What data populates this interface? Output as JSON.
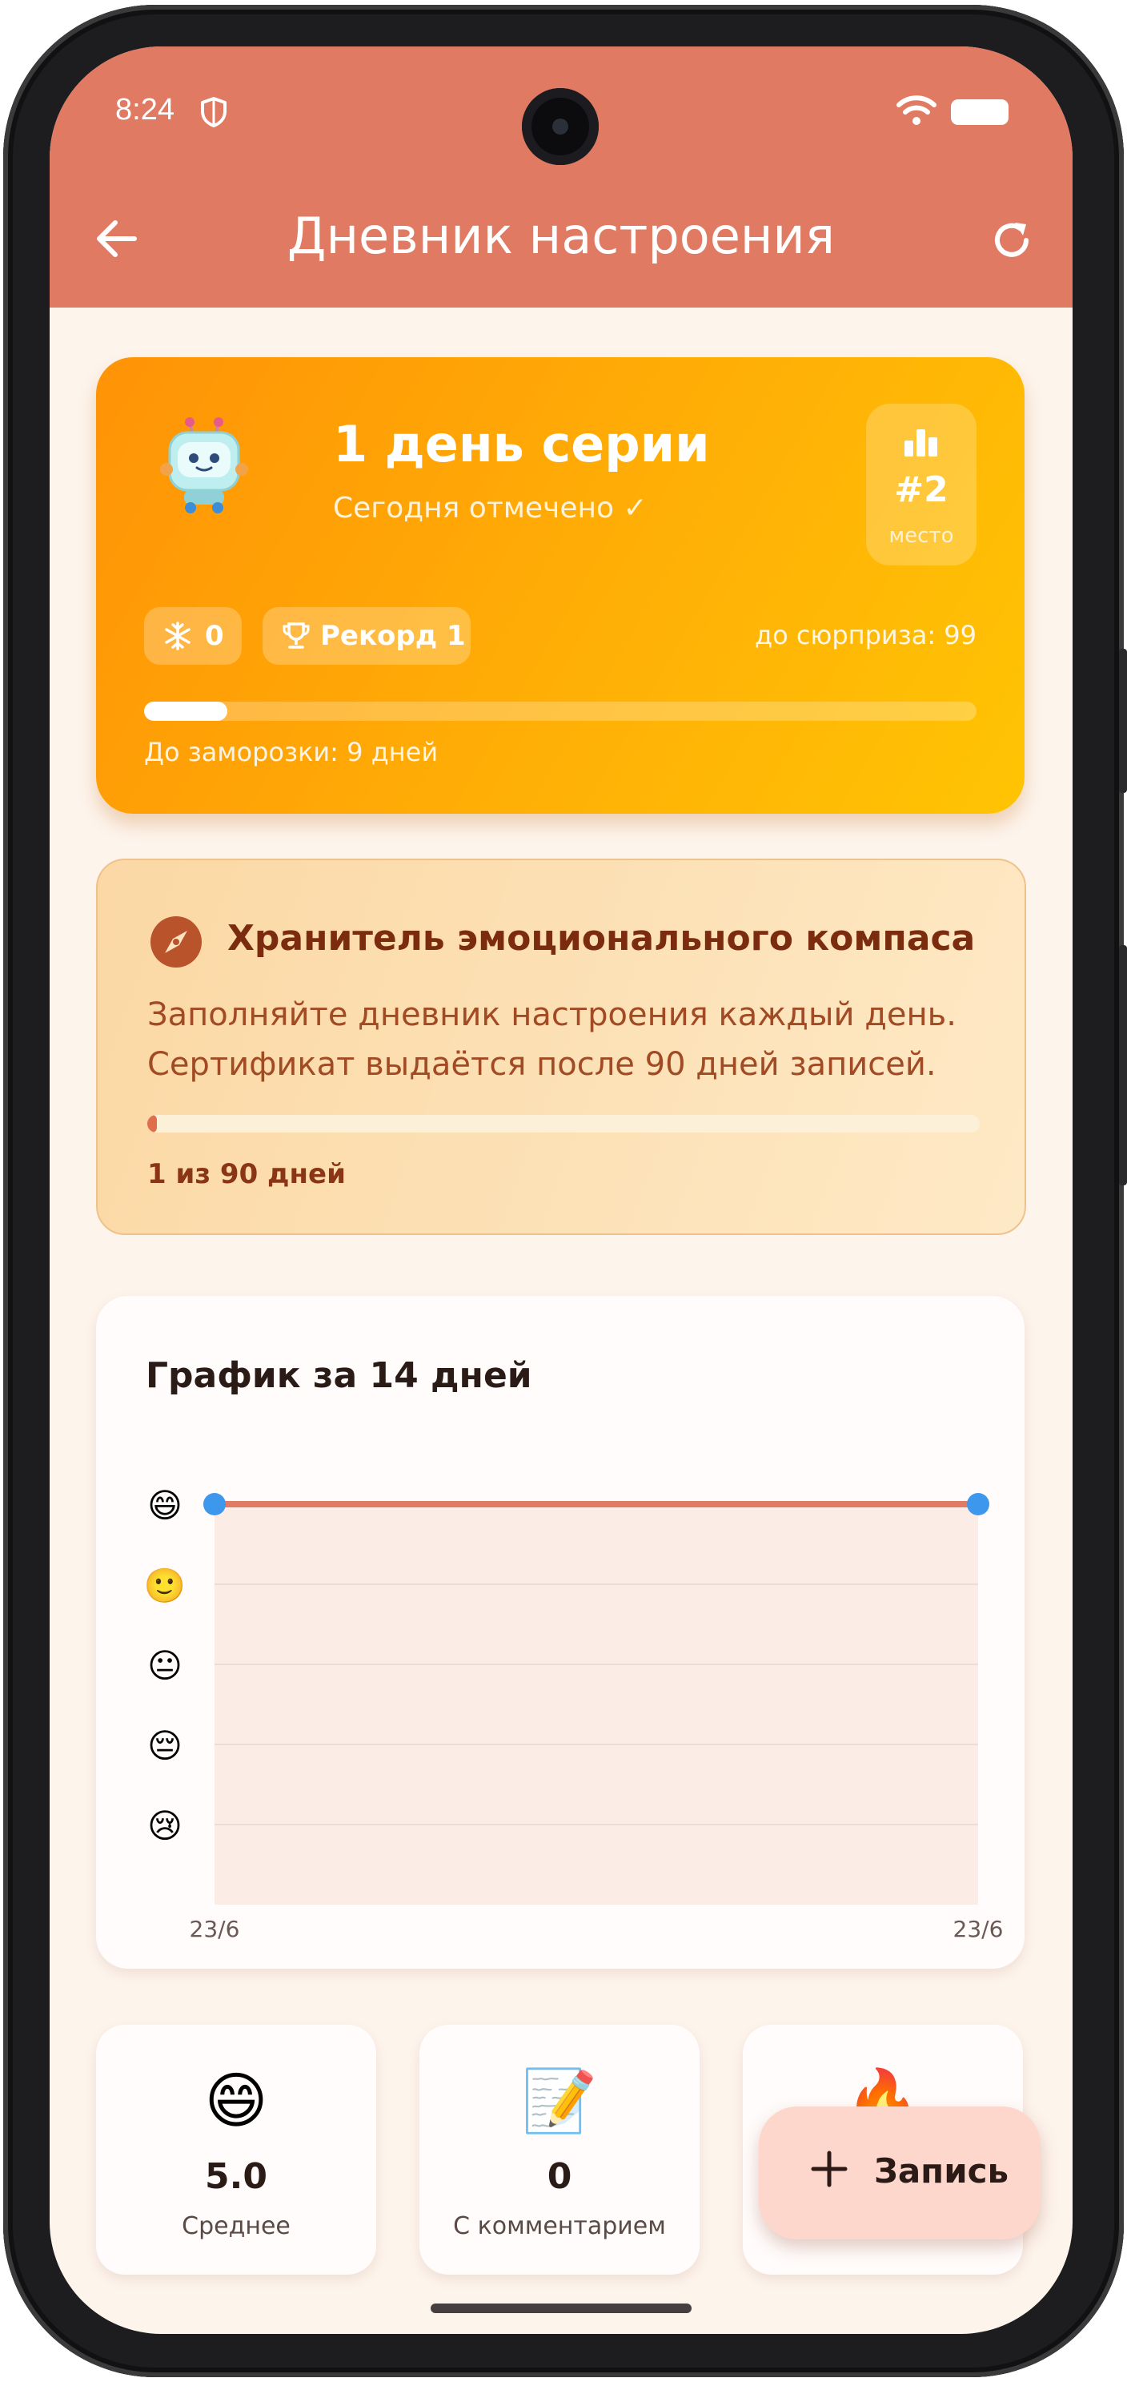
{
  "status_bar": {
    "time": "8:24"
  },
  "app_bar": {
    "title": "Дневник настроения",
    "back_icon": "arrow-back-icon",
    "refresh_icon": "refresh-icon"
  },
  "streak": {
    "mascot": "robot-icon",
    "title": "1 день серии",
    "subtitle": "Сегодня отмечено ✓",
    "rank": {
      "value": "#2",
      "label": "место",
      "icon": "bar-chart-icon"
    },
    "freeze_count": "0",
    "freeze_icon": "snowflake-icon",
    "record_label": "Рекорд 1",
    "record_icon": "trophy-icon",
    "surprise_text": "до сюрприза: 99",
    "progress_fraction": 0.1,
    "freeze_note": "До заморозки: 9 дней"
  },
  "achievement": {
    "icon": "compass-icon",
    "title": "Хранитель эмоционального компаса",
    "description": "Заполняйте дневник настроения каждый день. Сертификат выдаётся после 90 дней записей.",
    "progress_current": 1,
    "progress_total": 90,
    "progress_text": "1 из 90 дней"
  },
  "chart_section": {
    "title": "График за 14 дней"
  },
  "chart_data": {
    "type": "line",
    "title": "График за 14 дней",
    "x": [
      "23/6",
      "23/6"
    ],
    "values": [
      5,
      5
    ],
    "y_levels": [
      {
        "value": 5,
        "label": "😄"
      },
      {
        "value": 4,
        "label": "🙂"
      },
      {
        "value": 3,
        "label": "😐"
      },
      {
        "value": 2,
        "label": "😔"
      },
      {
        "value": 1,
        "label": "😢"
      }
    ],
    "ylim": [
      0,
      5
    ],
    "x_tick_labels": [
      "23/6",
      "23/6"
    ],
    "grid": true,
    "line_color": "#e07a62",
    "point_color": "#3d97ec",
    "area_color": "#fbece6"
  },
  "stats": [
    {
      "emoji": "😄",
      "value": "5.0",
      "label": "Среднее"
    },
    {
      "emoji": "📝",
      "value": "0",
      "label": "С комментарием"
    },
    {
      "emoji": "🔥",
      "value": "",
      "label": ""
    }
  ],
  "fab": {
    "label": "Запись",
    "icon": "plus-icon"
  },
  "colors": {
    "accent": "#e07a62",
    "background": "#fdf4ec",
    "streak_start": "#ff9306",
    "streak_end": "#ffc404"
  }
}
